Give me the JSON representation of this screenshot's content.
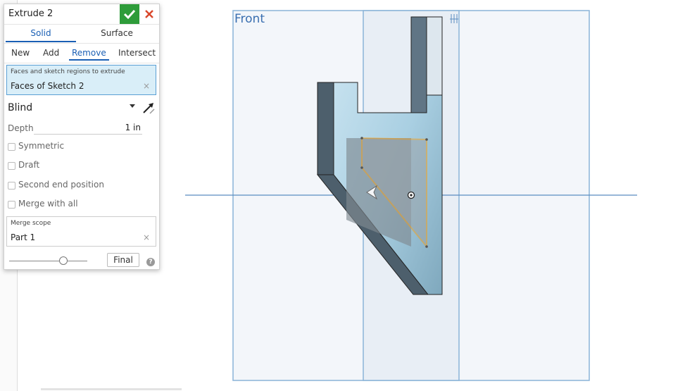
{
  "feature": {
    "title": "Extrude 2"
  },
  "body_type_tabs": [
    {
      "label": "Solid",
      "active": true
    },
    {
      "label": "Surface",
      "active": false
    }
  ],
  "operation_tabs": [
    {
      "label": "New",
      "active": false
    },
    {
      "label": "Add",
      "active": false
    },
    {
      "label": "Remove",
      "active": true
    },
    {
      "label": "Intersect",
      "active": false
    }
  ],
  "faces_selection": {
    "label": "Faces and sketch regions to extrude",
    "value": "Faces of Sketch 2"
  },
  "end_type": {
    "value": "Blind"
  },
  "depth": {
    "label": "Depth",
    "value": "1 in"
  },
  "options": {
    "symmetric": "Symmetric",
    "draft": "Draft",
    "second_end": "Second end position",
    "merge_all": "Merge with all"
  },
  "merge_scope": {
    "label": "Merge scope",
    "value": "Part 1"
  },
  "footer": {
    "final_label": "Final",
    "help_glyph": "?",
    "slider_position": 0.72
  },
  "viewport": {
    "plane_label": "Front"
  },
  "colors": {
    "accent": "#1a5fb4",
    "ok": "#2e9c3a",
    "cancel": "#d9472b",
    "plane_border": "#8ab4d8",
    "sketch_highlight": "#f0a020",
    "part_dark": "#4d5f6c"
  },
  "icons": {
    "ok": "checkmark-icon",
    "cancel": "close-icon",
    "flip": "flip-direction-arrow-icon",
    "origin": "origin-icon",
    "triad": "axis-triad-icon",
    "help": "help-icon"
  }
}
